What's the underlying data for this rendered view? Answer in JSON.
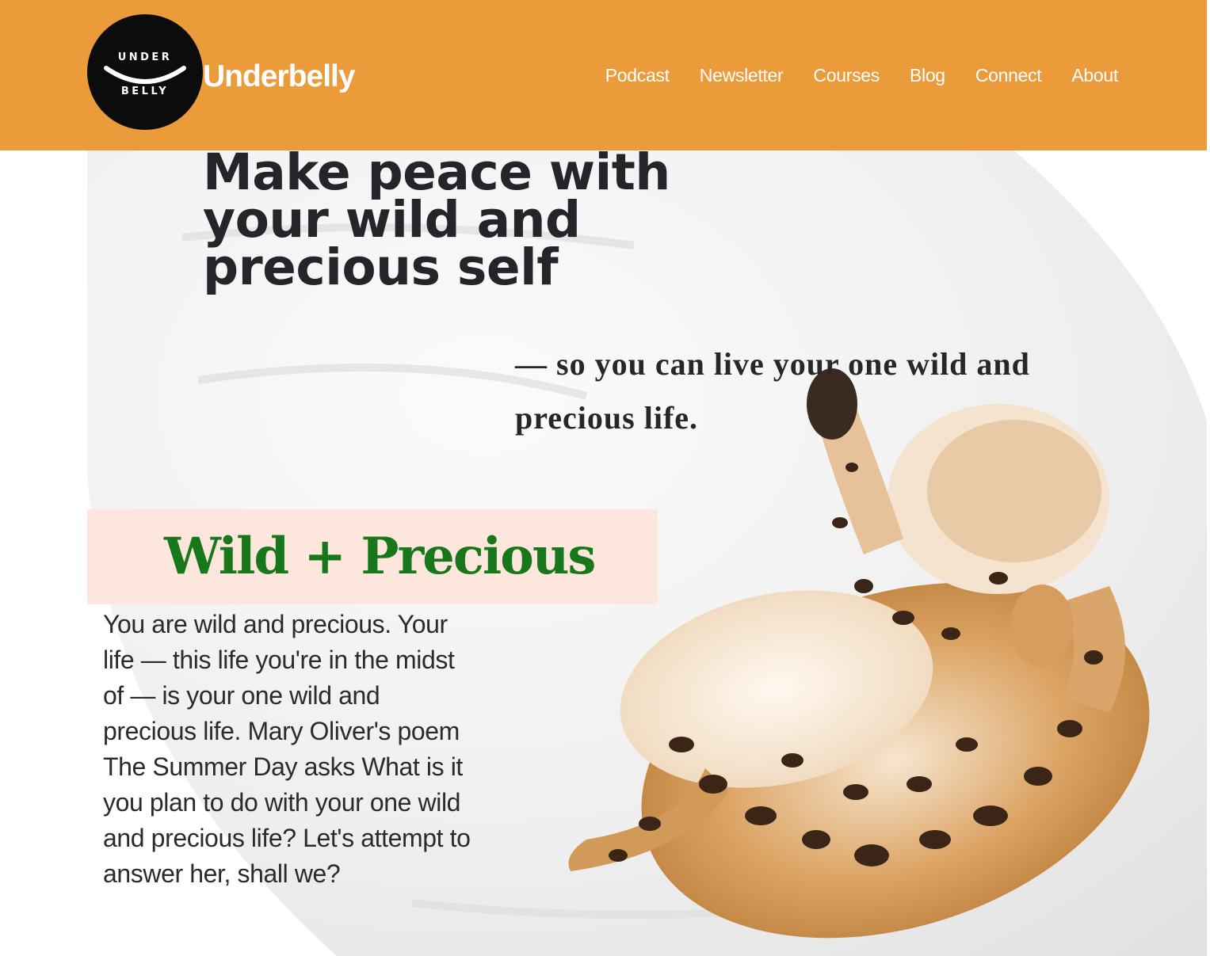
{
  "brand": {
    "logo_top": "UNDER",
    "logo_bottom": "BELLY",
    "name": "Underbelly",
    "header_color": "#ec9b3b"
  },
  "nav": {
    "items": [
      "Podcast",
      "Newsletter",
      "Courses",
      "Blog",
      "Connect",
      "About"
    ]
  },
  "hero": {
    "headline": "Make peace with your wild and precious self",
    "subline": "— so you can live your one wild and precious life.",
    "image": "cat-on-white-bed-icon"
  },
  "section": {
    "title": "Wild + Precious",
    "title_color": "#17771a",
    "band_color": "#fde7dc",
    "body": "You are wild and precious. Your life — this life you're in the midst of — is your one wild and precious life. Mary Oliver's poem The Summer Day asks What is it you plan to do with your one wild and precious life? Let's attempt to answer her, shall we?"
  }
}
